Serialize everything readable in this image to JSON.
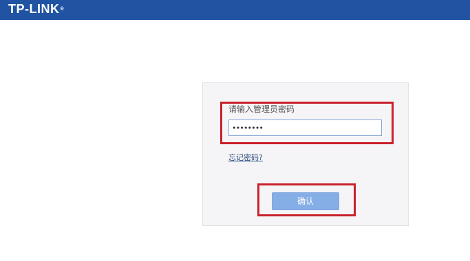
{
  "header": {
    "logo_text": "TP-LINK",
    "logo_mark": "®",
    "background_color": "#2153a3"
  },
  "login": {
    "password_label": "请输入管理员密码",
    "password_value": "••••••••",
    "forgot_password_link": "忘记密码?",
    "confirm_button": "确认",
    "highlight_color": "#c8202b"
  }
}
